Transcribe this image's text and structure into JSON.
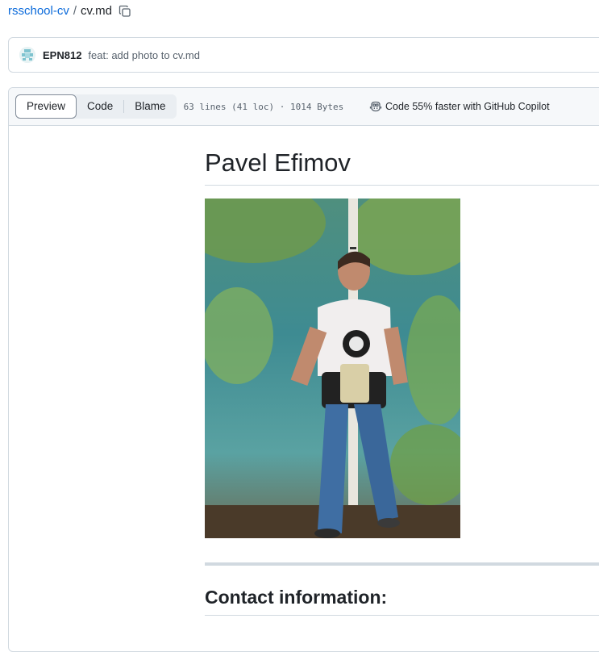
{
  "breadcrumb": {
    "repo": "rsschool-cv",
    "separator": "/",
    "file": "cv.md"
  },
  "commit": {
    "author": "EPN812",
    "message": "feat: add photo to cv.md"
  },
  "file_header": {
    "tabs": [
      {
        "label": "Preview",
        "active": true
      },
      {
        "label": "Code",
        "active": false
      },
      {
        "label": "Blame",
        "active": false
      }
    ],
    "meta": "63 lines (41 loc) · 1014 Bytes",
    "copilot": "Code 55% faster with GitHub Copilot"
  },
  "readme": {
    "title": "Pavel Efimov",
    "section_heading": "Contact information:"
  },
  "colors": {
    "link": "#0969da",
    "border": "#d1d9e0",
    "header_bg": "#f6f8fa"
  },
  "icons": [
    "copy-icon",
    "avatar-identicon",
    "copilot-icon"
  ]
}
